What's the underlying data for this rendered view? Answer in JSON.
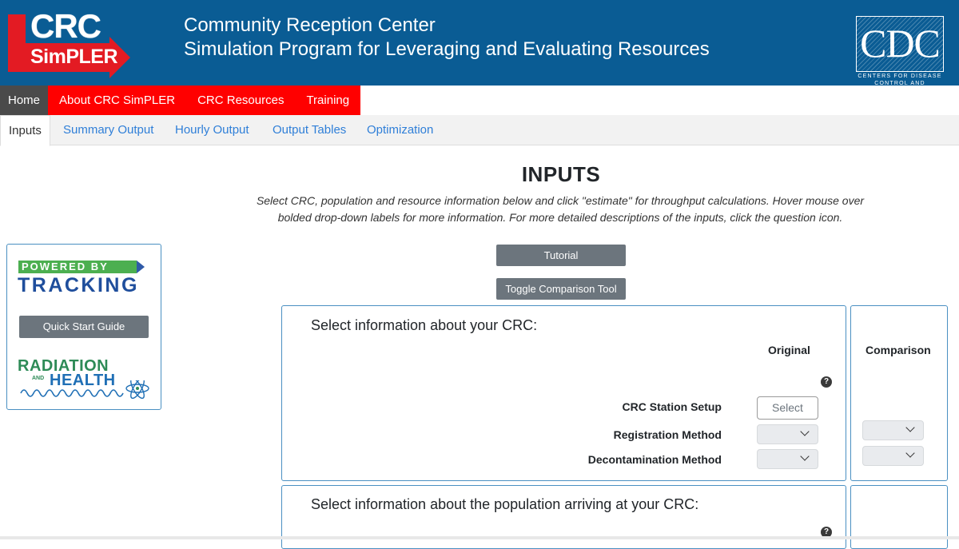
{
  "header": {
    "logo_top": "CRC",
    "logo_bottom": "SimPLER",
    "title_line1": "Community Reception Center",
    "title_line2": "Simulation Program for Leveraging and Evaluating Resources",
    "cdc_logo_text": "CDC",
    "cdc_sub1": "CENTERS FOR DISEASE",
    "cdc_sub2": "CONTROL AND PREVENTION"
  },
  "nav_primary": [
    "Home",
    "About CRC SimPLER",
    "CRC Resources",
    "Training"
  ],
  "nav_secondary": [
    "Inputs",
    "Summary Output",
    "Hourly Output",
    "Output Tables",
    "Optimization"
  ],
  "page": {
    "heading": "INPUTS",
    "instructions_line1": "Select CRC, population and resource information below and click \"estimate\" for throughput calculations. Hover mouse over",
    "instructions_line2": "bolded drop-down labels for more information. For more detailed descriptions of the inputs, click the question icon."
  },
  "sidebar": {
    "powered_by": "POWERED BY",
    "tracking": "TRACKING",
    "quick_start": "Quick Start Guide",
    "rh_radiation": "RADIATION",
    "rh_and": "AND",
    "rh_health": "HEALTH"
  },
  "buttons": {
    "tutorial": "Tutorial",
    "toggle": "Toggle Comparison Tool"
  },
  "crc_panel": {
    "title": "Select information about your CRC:",
    "col_original": "Original",
    "col_comparison": "Comparison",
    "help": "?",
    "station_setup_label": "CRC Station Setup",
    "station_setup_button": "Select",
    "registration_label": "Registration Method",
    "decon_label": "Decontamination Method"
  },
  "population_panel": {
    "title": "Select information about the population arriving at your CRC:",
    "help": "?"
  }
}
